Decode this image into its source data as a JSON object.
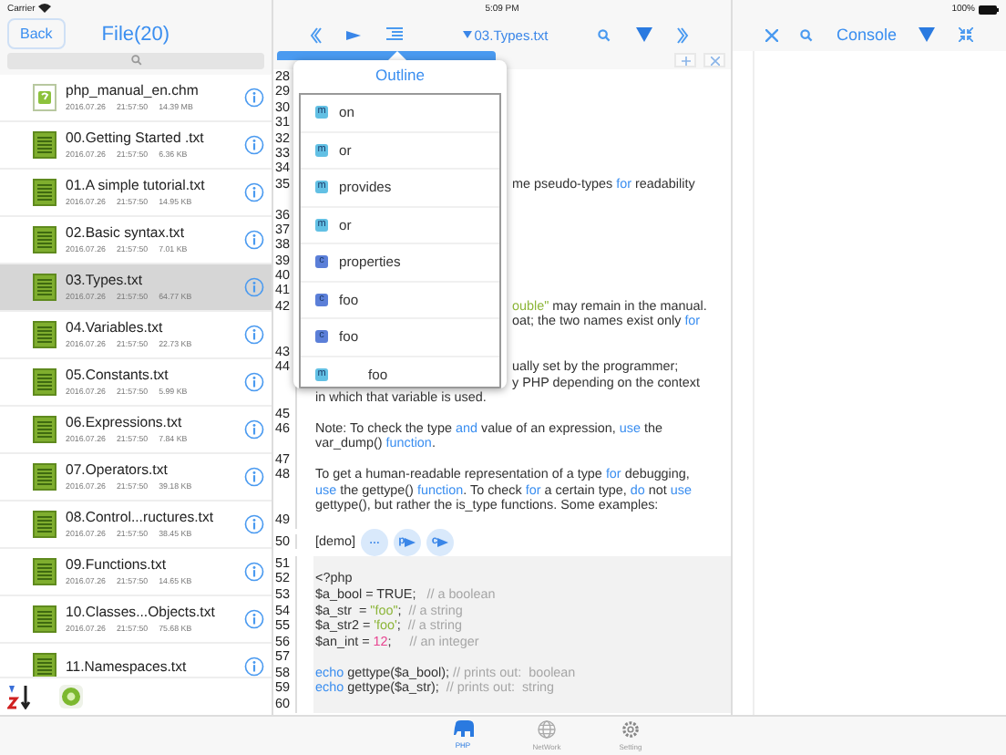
{
  "status_bar": {
    "carrier": "Carrier",
    "time": "5:09 PM",
    "battery": "100%"
  },
  "file_panel": {
    "back": "Back",
    "title": "File(20)",
    "files": [
      {
        "name": "php_manual_en.chm",
        "kind": "chm",
        "date": "2016.07.26",
        "time": "21:57:50",
        "size": "14.39 MB",
        "selected": false
      },
      {
        "name": "00.Getting Started .txt",
        "kind": "txt",
        "date": "2016.07.26",
        "time": "21:57:50",
        "size": "6.36 KB",
        "selected": false
      },
      {
        "name": "01.A simple tutorial.txt",
        "kind": "txt",
        "date": "2016.07.26",
        "time": "21:57:50",
        "size": "14.95 KB",
        "selected": false
      },
      {
        "name": "02.Basic syntax.txt",
        "kind": "txt",
        "date": "2016.07.26",
        "time": "21:57:50",
        "size": "7.01 KB",
        "selected": false
      },
      {
        "name": "03.Types.txt",
        "kind": "txt",
        "date": "2016.07.26",
        "time": "21:57:50",
        "size": "64.77 KB",
        "selected": true
      },
      {
        "name": "04.Variables.txt",
        "kind": "txt",
        "date": "2016.07.26",
        "time": "21:57:50",
        "size": "22.73 KB",
        "selected": false
      },
      {
        "name": "05.Constants.txt",
        "kind": "txt",
        "date": "2016.07.26",
        "time": "21:57:50",
        "size": "5.99 KB",
        "selected": false
      },
      {
        "name": "06.Expressions.txt",
        "kind": "txt",
        "date": "2016.07.26",
        "time": "21:57:50",
        "size": "7.84 KB",
        "selected": false
      },
      {
        "name": "07.Operators.txt",
        "kind": "txt",
        "date": "2016.07.26",
        "time": "21:57:50",
        "size": "39.18 KB",
        "selected": false
      },
      {
        "name": "08.Control...ructures.txt",
        "kind": "txt",
        "date": "2016.07.26",
        "time": "21:57:50",
        "size": "38.45 KB",
        "selected": false
      },
      {
        "name": "09.Functions.txt",
        "kind": "txt",
        "date": "2016.07.26",
        "time": "21:57:50",
        "size": "14.65 KB",
        "selected": false
      },
      {
        "name": "10.Classes...Objects.txt",
        "kind": "txt",
        "date": "2016.07.26",
        "time": "21:57:50",
        "size": "75.68 KB",
        "selected": false
      },
      {
        "name": "11.Namespaces.txt",
        "kind": "txt",
        "selected": false
      }
    ]
  },
  "editor": {
    "file": "03.Types.txt",
    "lines": [
      {
        "num": "28",
        "kind": "text"
      },
      {
        "num": "29",
        "kind": "text"
      },
      {
        "num": "30",
        "kind": "text"
      },
      {
        "num": "31",
        "kind": "text"
      },
      {
        "num": "32",
        "kind": "text"
      },
      {
        "num": "33",
        "kind": "text"
      },
      {
        "num": "34",
        "kind": "text"
      },
      {
        "num": "35",
        "kind": "partial",
        "parts": [
          {
            "text": "me pseudo-types ",
            "kind": "plain"
          },
          {
            "text": "for",
            "kind": "keyword"
          },
          {
            "text": " readability",
            "kind": "plain"
          }
        ]
      },
      {
        "kind": "text"
      },
      {
        "num": "36",
        "kind": "text"
      },
      {
        "num": "37",
        "kind": "text"
      },
      {
        "num": "38",
        "kind": "text"
      },
      {
        "num": "39",
        "kind": "text"
      },
      {
        "num": "40",
        "kind": "text"
      },
      {
        "num": "41",
        "kind": "text"
      },
      {
        "num": "42",
        "kind": "partial",
        "parts": [
          {
            "text": "ouble\"",
            "kind": "string"
          },
          {
            "text": " may remain in the manual.",
            "kind": "plain"
          }
        ]
      },
      {
        "kind": "partial",
        "parts": [
          {
            "text": "oat; the two names exist only ",
            "kind": "plain"
          },
          {
            "text": "for",
            "kind": "keyword"
          }
        ]
      },
      {
        "kind": "text"
      },
      {
        "num": "43",
        "kind": "text"
      },
      {
        "num": "44",
        "kind": "partial",
        "parts": [
          {
            "text": "ually set by the programmer;",
            "kind": "plain"
          }
        ]
      },
      {
        "kind": "partial",
        "parts": [
          {
            "text": "y PHP depending on the context",
            "kind": "plain"
          }
        ]
      },
      {
        "kind": "text",
        "parts": [
          {
            "text": "in which that variable is used.",
            "kind": "plain"
          }
        ]
      },
      {
        "num": "45",
        "kind": "text"
      },
      {
        "num": "46",
        "kind": "text",
        "parts": [
          {
            "text": "Note: To check the type ",
            "kind": "plain"
          },
          {
            "text": "and",
            "kind": "keyword"
          },
          {
            "text": " value of an expression, ",
            "kind": "plain"
          },
          {
            "text": "use",
            "kind": "keyword"
          },
          {
            "text": " the",
            "kind": "plain"
          }
        ]
      },
      {
        "kind": "text",
        "parts": [
          {
            "text": "var_dump() ",
            "kind": "plain"
          },
          {
            "text": "function",
            "kind": "keyword"
          },
          {
            "text": ".",
            "kind": "plain"
          }
        ]
      },
      {
        "num": "47",
        "kind": "text"
      },
      {
        "num": "48",
        "kind": "text",
        "parts": [
          {
            "text": "To get a human-readable representation of a type ",
            "kind": "plain"
          },
          {
            "text": "for",
            "kind": "keyword"
          },
          {
            "text": " debugging,",
            "kind": "plain"
          }
        ]
      },
      {
        "kind": "text",
        "parts": [
          {
            "text": "use",
            "kind": "keyword"
          },
          {
            "text": " the gettype() ",
            "kind": "plain"
          },
          {
            "text": "function",
            "kind": "keyword"
          },
          {
            "text": ". To check ",
            "kind": "plain"
          },
          {
            "text": "for",
            "kind": "keyword"
          },
          {
            "text": " a certain type, ",
            "kind": "plain"
          },
          {
            "text": "do",
            "kind": "keyword"
          },
          {
            "text": " not ",
            "kind": "plain"
          },
          {
            "text": "use",
            "kind": "keyword"
          }
        ]
      },
      {
        "kind": "text",
        "parts": [
          {
            "text": "gettype(), but rather the is_type functions. Some examples:",
            "kind": "plain"
          }
        ]
      },
      {
        "num": "49",
        "kind": "text"
      },
      {
        "num": "50",
        "kind": "demo",
        "parts": [
          {
            "text": "[demo]",
            "kind": "plain"
          }
        ],
        "buttons": [
          {
            "label": "…",
            "kind": "more"
          },
          {
            "label": "p",
            "kind": "run"
          },
          {
            "label": "c",
            "kind": "run"
          }
        ]
      },
      {
        "num": "51",
        "kind": "code"
      },
      {
        "num": "52",
        "kind": "code",
        "parts": [
          {
            "text": "<?php",
            "kind": "plain"
          }
        ]
      },
      {
        "num": "53",
        "kind": "code",
        "parts": [
          {
            "text": "$a_bool = TRUE;   ",
            "kind": "plain"
          },
          {
            "text": "// a boolean",
            "kind": "comment"
          }
        ]
      },
      {
        "num": "54",
        "kind": "code",
        "parts": [
          {
            "text": "$a_str  = ",
            "kind": "plain"
          },
          {
            "text": "\"foo\"",
            "kind": "string"
          },
          {
            "text": ";  ",
            "kind": "plain"
          },
          {
            "text": "// a string",
            "kind": "comment"
          }
        ]
      },
      {
        "num": "55",
        "kind": "code",
        "parts": [
          {
            "text": "$a_str2 = ",
            "kind": "plain"
          },
          {
            "text": "'foo'",
            "kind": "string"
          },
          {
            "text": ";  ",
            "kind": "plain"
          },
          {
            "text": "// a string",
            "kind": "comment"
          }
        ]
      },
      {
        "num": "56",
        "kind": "code",
        "parts": [
          {
            "text": "$an_int = ",
            "kind": "plain"
          },
          {
            "text": "12",
            "kind": "number"
          },
          {
            "text": ";     ",
            "kind": "plain"
          },
          {
            "text": "// an integer",
            "kind": "comment"
          }
        ]
      },
      {
        "num": "57",
        "kind": "code"
      },
      {
        "num": "58",
        "kind": "code",
        "parts": [
          {
            "text": "echo",
            "kind": "keyword"
          },
          {
            "text": " gettype($a_bool); ",
            "kind": "plain"
          },
          {
            "text": "// prints out:  boolean",
            "kind": "comment"
          }
        ]
      },
      {
        "num": "59",
        "kind": "code",
        "parts": [
          {
            "text": "echo",
            "kind": "keyword"
          },
          {
            "text": " gettype($a_str);  ",
            "kind": "plain"
          },
          {
            "text": "// prints out:  string",
            "kind": "comment"
          }
        ]
      },
      {
        "num": "60",
        "kind": "code"
      }
    ],
    "outline": {
      "title": "Outline",
      "items": [
        {
          "label": "on",
          "badge": "m",
          "kind": "method"
        },
        {
          "label": "or",
          "badge": "m",
          "kind": "method"
        },
        {
          "label": "provides",
          "badge": "m",
          "kind": "method"
        },
        {
          "label": "or",
          "badge": "m",
          "kind": "method"
        },
        {
          "label": "properties",
          "badge": "c",
          "kind": "class"
        },
        {
          "label": "foo",
          "badge": "c",
          "kind": "class"
        },
        {
          "label": "foo",
          "badge": "c",
          "kind": "class",
          "children": [
            {
              "label": "foo",
              "badge": "m",
              "kind": "method"
            }
          ]
        }
      ]
    }
  },
  "console": {
    "title": "Console"
  },
  "tab_bar": [
    {
      "label": "PHP",
      "kind": "php",
      "selected": true
    },
    {
      "label": "NetWork",
      "kind": "network",
      "selected": false
    },
    {
      "label": "Setting",
      "kind": "setting",
      "selected": false
    }
  ]
}
